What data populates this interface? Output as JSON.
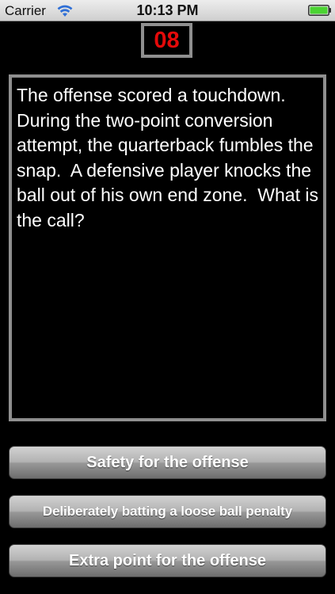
{
  "status_bar": {
    "carrier": "Carrier",
    "time": "10:13 PM",
    "wifi_icon": "wifi-icon",
    "battery_icon": "battery-icon",
    "battery_color": "#4cd433"
  },
  "timer": {
    "value": "08",
    "color": "#e40a0a"
  },
  "question": {
    "text": "The offense scored a touchdown.  During the two-point conversion attempt, the quarterback fumbles the snap.  A defensive player knocks the ball out of his own end zone.  What is the call?"
  },
  "answers": [
    {
      "label": "Safety for the offense"
    },
    {
      "label": "Deliberately batting a loose ball penalty"
    },
    {
      "label": "Extra point for the offense"
    }
  ]
}
